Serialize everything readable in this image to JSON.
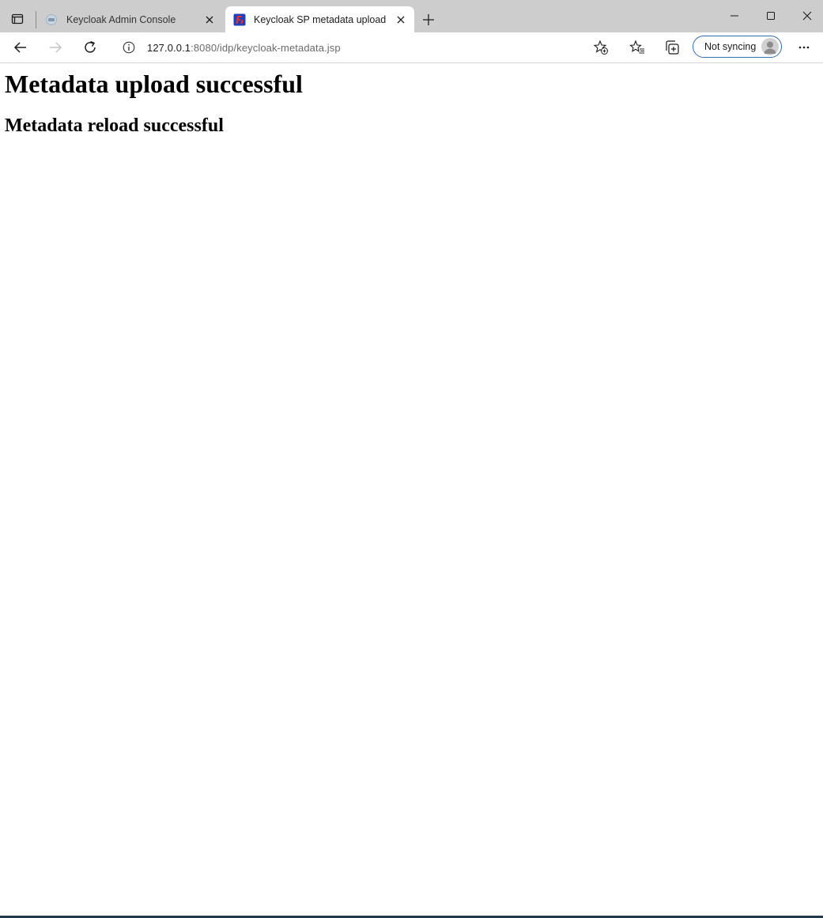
{
  "tabs": [
    {
      "title": "Keycloak Admin Console",
      "favicon": "keycloak-icon",
      "active": false
    },
    {
      "title": "Keycloak SP metadata upload",
      "favicon": "app-logo-icon",
      "active": true
    }
  ],
  "address": {
    "host": "127.0.0.1",
    "rest": ":8080/idp/keycloak-metadata.jsp"
  },
  "profile": {
    "label": "Not syncing"
  },
  "page": {
    "heading": "Metadata upload successful",
    "subheading": "Metadata reload successful"
  },
  "colors": {
    "tabbar_bg": "#cdcdcd",
    "profile_border": "#2f6fb6",
    "taskbar": "#203a4c"
  }
}
